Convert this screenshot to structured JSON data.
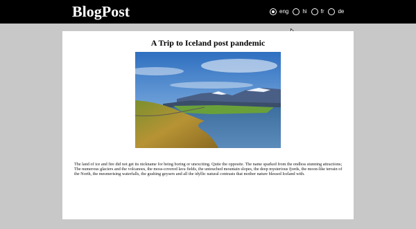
{
  "navbar": {
    "brand": "BlogPost",
    "languages": [
      {
        "code": "eng",
        "label": "eng",
        "selected": true
      },
      {
        "code": "hi",
        "label": "hi",
        "selected": false
      },
      {
        "code": "fr",
        "label": "fr",
        "selected": false
      },
      {
        "code": "de",
        "label": "de",
        "selected": false
      }
    ]
  },
  "post": {
    "title": "A Trip to Iceland post pandemic",
    "body": "The land of ice and fire did not get its nickname for being boring or unexciting. Quite the opposite. The name sparked from the endless stunning attractions; The numerous glaciers and the volcanoes, the moss-covered lava fields, the untouched mountain slopes, the deep mysterious fjords, the moon-like terrain of the North, the mesmerising waterfalls, the gushing geysers and all the idyllic natural contrasts that mother nature blessed Iceland with."
  },
  "colors": {
    "navbar": "#000000",
    "page_background": "#c8c8c8",
    "card": "#ffffff"
  }
}
